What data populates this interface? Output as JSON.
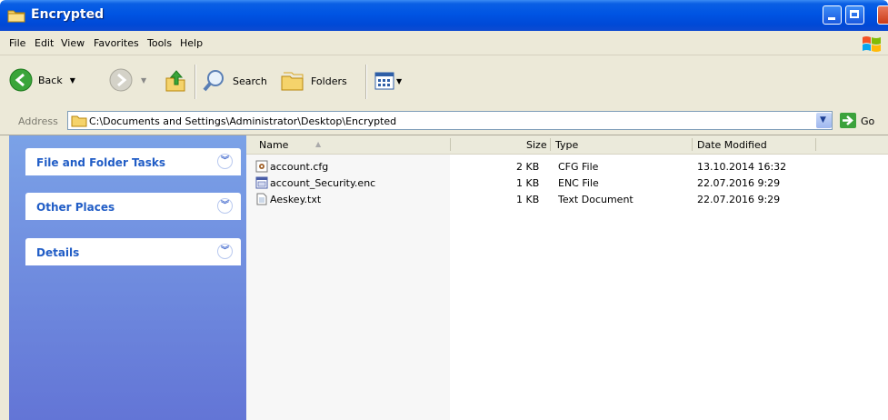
{
  "window": {
    "title": "Encrypted"
  },
  "menu": [
    "File",
    "Edit",
    "View",
    "Favorites",
    "Tools",
    "Help"
  ],
  "toolbar": {
    "back": "Back",
    "search": "Search",
    "folders": "Folders"
  },
  "address": {
    "label": "Address",
    "path": "C:\\Documents and Settings\\Administrator\\Desktop\\Encrypted",
    "go": "Go"
  },
  "tasks": [
    {
      "label": "File and Folder Tasks"
    },
    {
      "label": "Other Places"
    },
    {
      "label": "Details"
    }
  ],
  "columns": {
    "name": "Name",
    "size": "Size",
    "type": "Type",
    "date": "Date Modified"
  },
  "files": [
    {
      "name": "account.cfg",
      "size": "2 KB",
      "type": "CFG File",
      "date": "13.10.2014 16:32",
      "icon": "config-file-icon"
    },
    {
      "name": "account_Security.enc",
      "size": "1 KB",
      "type": "ENC File",
      "date": "22.07.2016 9:29",
      "icon": "enc-file-icon"
    },
    {
      "name": "Aeskey.txt",
      "size": "1 KB",
      "type": "Text Document",
      "date": "22.07.2016 9:29",
      "icon": "text-file-icon"
    }
  ],
  "colors": {
    "titlebar": "#0054e3",
    "taskpane": "#7ba2e7",
    "tasklabel": "#215dc6"
  }
}
